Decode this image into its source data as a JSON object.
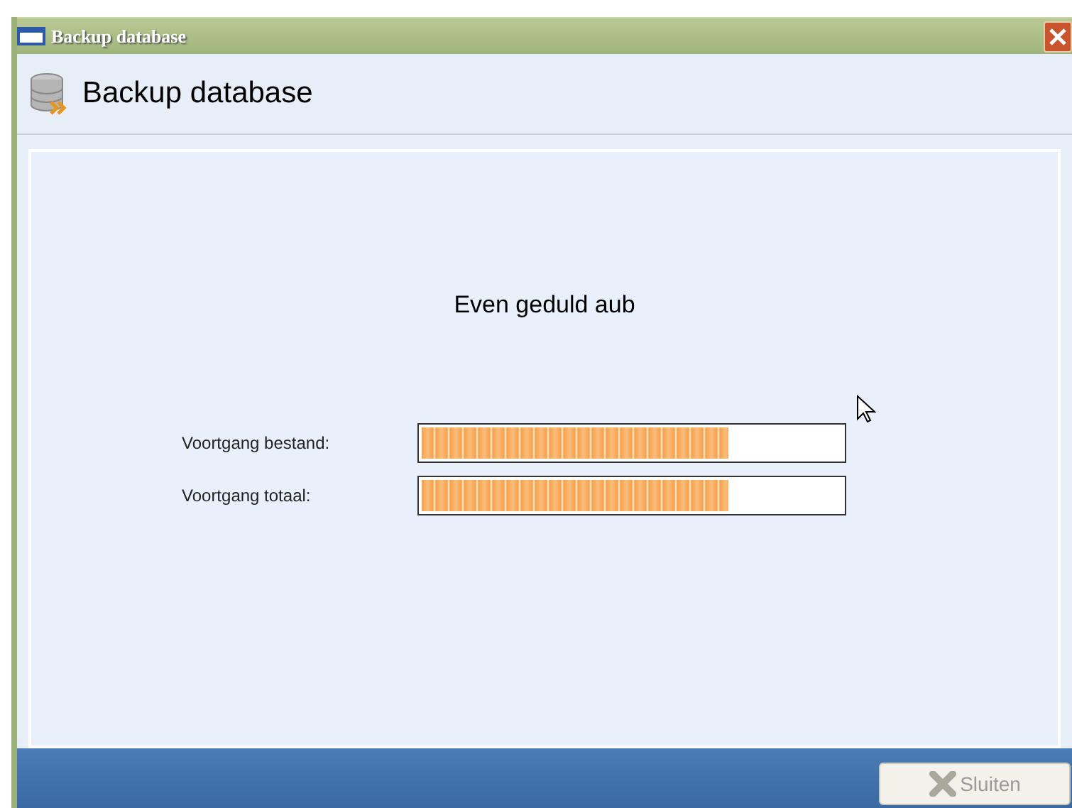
{
  "window": {
    "title": "Backup database"
  },
  "header": {
    "title": "Backup database"
  },
  "message": "Even geduld aub",
  "progress": [
    {
      "label": "Voortgang bestand:",
      "level": 0.73
    },
    {
      "label": "Voortgang totaal:",
      "level": 0.73
    }
  ],
  "buttons": [
    {
      "label": "Sluiten",
      "disabled": true
    }
  ]
}
